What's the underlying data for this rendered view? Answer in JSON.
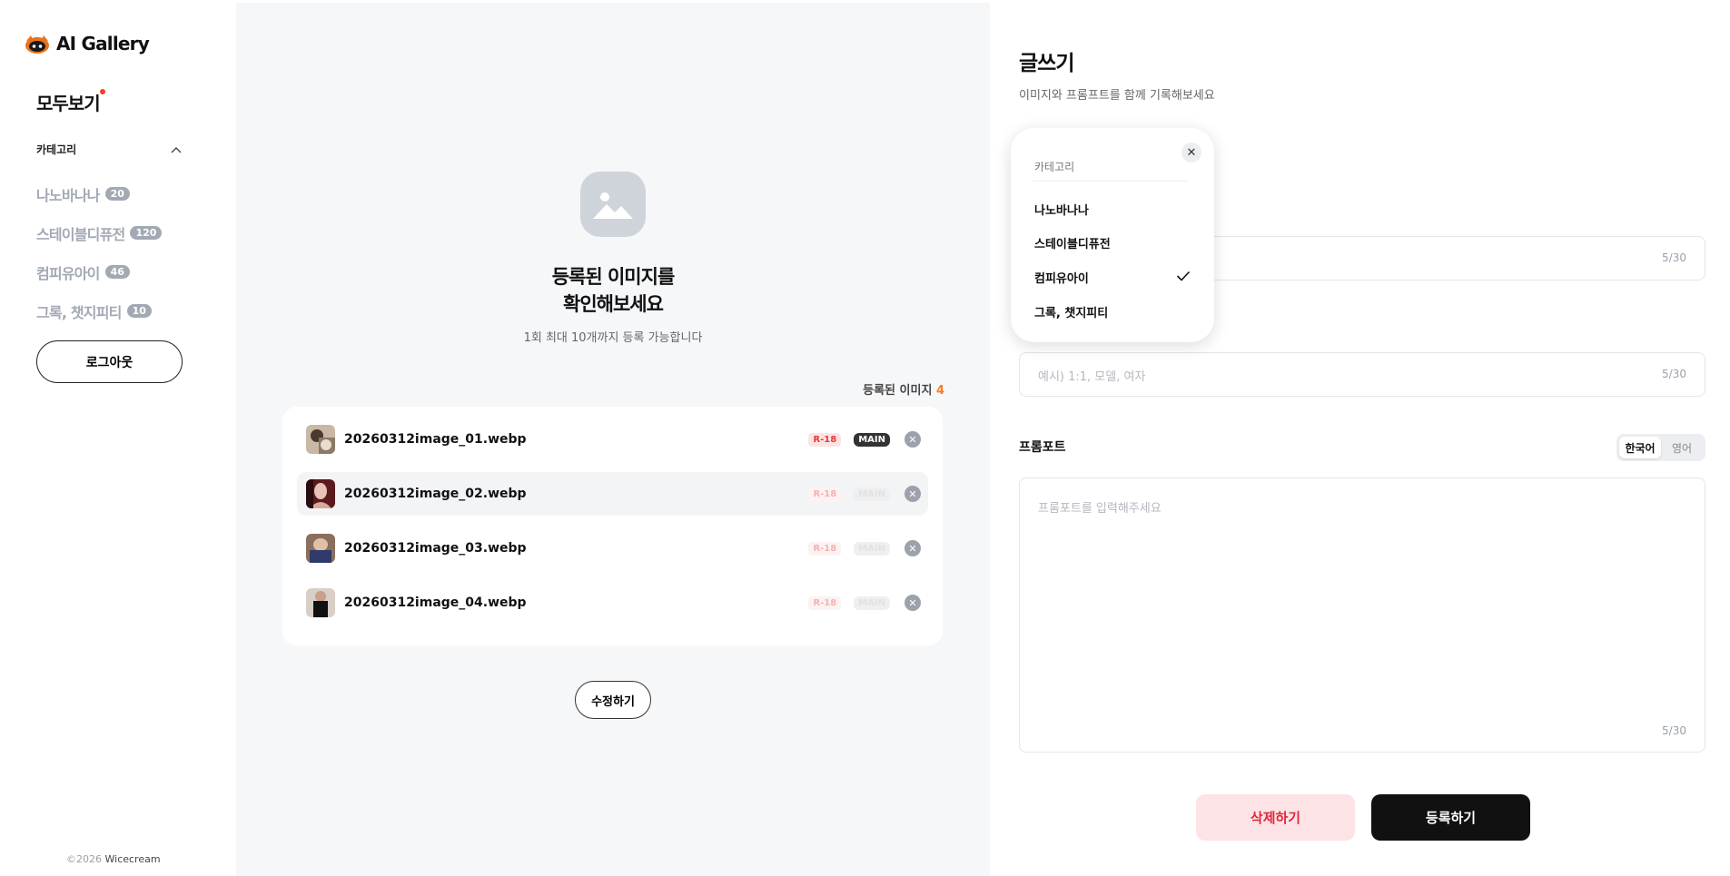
{
  "brand": {
    "name": "AI Gallery"
  },
  "sidebar": {
    "view_all": "모두보기",
    "category_header": "카테고리",
    "categories": [
      {
        "label": "나노바나나",
        "count": "20"
      },
      {
        "label": "스테이블디퓨전",
        "count": "120"
      },
      {
        "label": "컴피유아이",
        "count": "46"
      },
      {
        "label": "그록, 챗지피티",
        "count": "10"
      }
    ],
    "logout_label": "로그아웃",
    "footer": {
      "copyright": "©2026",
      "company": "Wicecream"
    }
  },
  "images_panel": {
    "title_line1": "등록된 이미지를",
    "title_line2": "확인해보세요",
    "subtitle": "1회 최대 10개까지 등록 가능합니다",
    "registered_label": "등록된 이미지",
    "registered_count": "4",
    "files": [
      {
        "name": "20260312image_01.webp",
        "r18": "R-18",
        "main": "MAIN",
        "active": true
      },
      {
        "name": "20260312image_02.webp",
        "r18": "R-18",
        "main": "MAIN",
        "active": false
      },
      {
        "name": "20260312image_03.webp",
        "r18": "R-18",
        "main": "MAIN",
        "active": false
      },
      {
        "name": "20260312image_04.webp",
        "r18": "R-18",
        "main": "MAIN",
        "active": false
      }
    ],
    "edit_label": "수정하기"
  },
  "form": {
    "title": "글쓰기",
    "subtitle": "이미지와 프롬프트를 함께 기록해보세요",
    "field1": {
      "counter": "5/30"
    },
    "field2": {
      "placeholder": "예시) 1:1, 모델, 여자",
      "counter": "5/30"
    },
    "prompt": {
      "label": "프롬포트",
      "lang_options": [
        "한국어",
        "영어"
      ],
      "selected_lang": "한국어",
      "placeholder": "프롬포트를 입력해주세요",
      "counter": "5/30"
    },
    "delete_label": "삭제하기",
    "submit_label": "등록하기"
  },
  "category_dropdown": {
    "header": "카테고리",
    "options": [
      "나노바나나",
      "스테이블디퓨전",
      "컴피유아이",
      "그록, 챗지피티"
    ],
    "selected": "컴피유아이",
    "close_icon": "close-icon",
    "check_icon": "check-icon"
  },
  "colors": {
    "accent_orange": "#ff7a1a",
    "danger": "#e0283e",
    "danger_bg": "#fde3e6",
    "primary": "#111111"
  }
}
